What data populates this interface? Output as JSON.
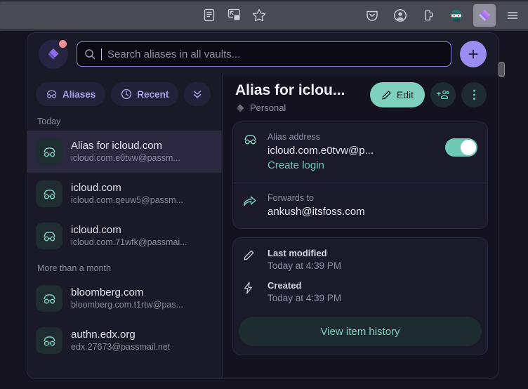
{
  "browser": {
    "url_icons": [
      {
        "name": "reader-view-icon",
        "glyph": "reader"
      },
      {
        "name": "picture-in-picture-icon",
        "glyph": "pip"
      },
      {
        "name": "bookmark-star-icon",
        "glyph": "star"
      }
    ],
    "toolbar_buttons": [
      {
        "name": "pocket-icon",
        "glyph": "pocket"
      },
      {
        "name": "account-icon",
        "glyph": "account"
      },
      {
        "name": "extensions-icon",
        "glyph": "extension"
      },
      {
        "name": "bitwarden-extension-icon",
        "glyph": "mascot"
      },
      {
        "name": "proton-pass-extension-icon",
        "glyph": "pass",
        "active": true
      },
      {
        "name": "app-menu-icon",
        "glyph": "hamburger"
      }
    ],
    "chrome_bg": "#42414d"
  },
  "popup": {
    "search": {
      "placeholder": "Search aliases in all vaults...",
      "value": "",
      "icon": "search-icon"
    },
    "brand": {
      "name": "proton-pass-logo",
      "notification": true
    },
    "add_button_label": "+",
    "filters": [
      {
        "label": "Aliases",
        "icon": "incognito-mask-icon",
        "name": "filter-aliases"
      },
      {
        "label": "Recent",
        "icon": "clock-icon",
        "name": "filter-recent"
      }
    ],
    "filter_more_icon": "double-chevron-down-icon",
    "groups": [
      {
        "label": "Today",
        "items": [
          {
            "title": "Alias for icloud.com",
            "subtitle": "icloud.com.e0tvw@passm...",
            "selected": true
          },
          {
            "title": "icloud.com",
            "subtitle": "icloud.com.qeuw5@passm...",
            "selected": false
          },
          {
            "title": "icloud.com",
            "subtitle": "icloud.com.71wfk@passmai...",
            "selected": false
          }
        ]
      },
      {
        "label": "More than a month",
        "items": [
          {
            "title": "bloomberg.com",
            "subtitle": "bloomberg.com.t1rtw@pas...",
            "selected": false
          },
          {
            "title": "authn.edx.org",
            "subtitle": "edx.27673@passmail.net",
            "selected": false
          }
        ]
      }
    ],
    "detail": {
      "title": "Alias for iclou...",
      "vault": "Personal",
      "edit_label": "Edit",
      "share_icon": "share-add-user-icon",
      "more_icon": "more-vertical-icon",
      "alias": {
        "label": "Alias address",
        "value": "icloud.com.e0tvw@p...",
        "link": "Create login",
        "enabled": true
      },
      "forwards": {
        "label": "Forwards to",
        "value": "ankush@itsfoss.com"
      },
      "last_modified": {
        "label": "Last modified",
        "value": "Today at 4:39 PM"
      },
      "created": {
        "label": "Created",
        "value": "Today at 4:39 PM"
      },
      "history_button": "View item history"
    }
  },
  "colors": {
    "accent_teal": "#7fd0bd",
    "accent_purple": "#9a8cf0",
    "panel_bg": "#191927",
    "detail_bg": "#14121f"
  }
}
